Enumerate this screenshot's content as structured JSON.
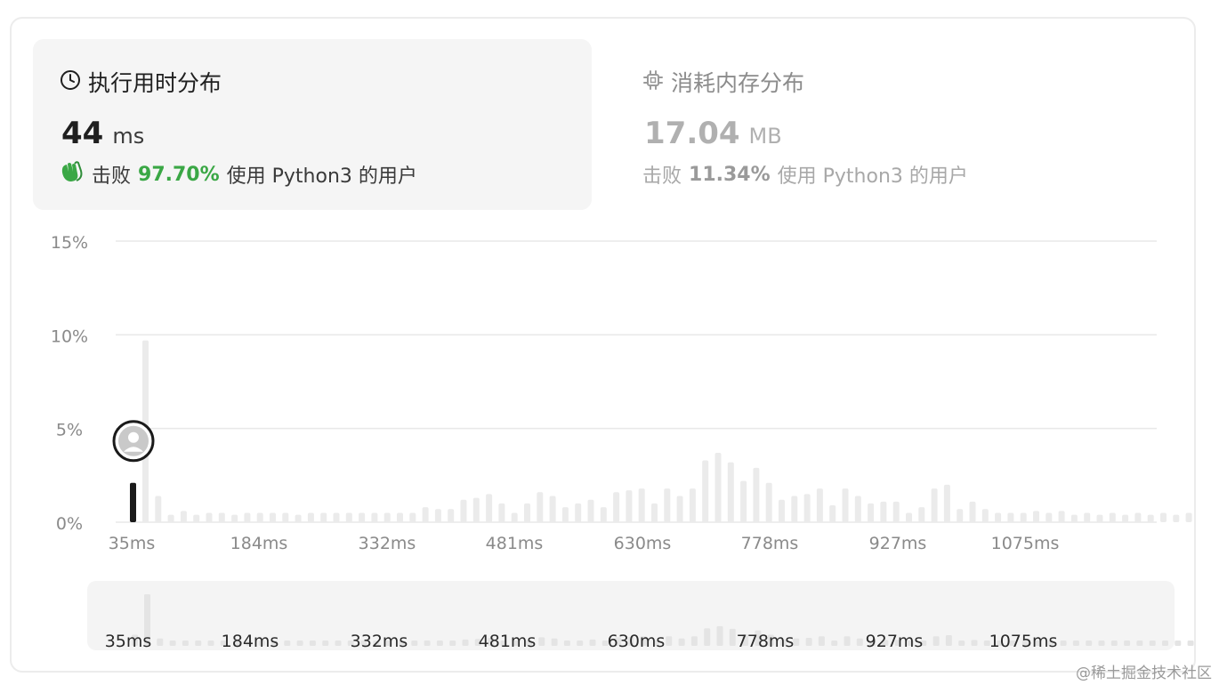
{
  "tabs": {
    "runtime": {
      "title": "执行用时分布",
      "value": "44",
      "unit": "ms",
      "beat_prefix": "击败",
      "beat_pct": "97.70%",
      "beat_suffix": "使用 Python3 的用户",
      "icon": "clock-icon",
      "badge_icon": "clapping-hands-icon"
    },
    "memory": {
      "title": "消耗内存分布",
      "value": "17.04",
      "unit": "MB",
      "beat_prefix": "击败",
      "beat_pct": "11.34%",
      "beat_suffix": "使用 Python3 的用户",
      "icon": "chip-icon"
    }
  },
  "watermark": "@稀土掘金技术社区",
  "colors": {
    "bar": "#ebebeb",
    "highlight_bar": "#1a1a1a",
    "pass_green": "#3aa745"
  },
  "chart_data": {
    "type": "bar",
    "ylim": [
      0,
      15
    ],
    "y_ticks": [
      "0%",
      "5%",
      "10%",
      "15%"
    ],
    "x_tick_labels": [
      "35ms",
      "184ms",
      "332ms",
      "481ms",
      "630ms",
      "778ms",
      "927ms",
      "1075ms"
    ],
    "values": [
      2.1,
      9.7,
      1.4,
      0.4,
      0.6,
      0.4,
      0.5,
      0.5,
      0.4,
      0.5,
      0.5,
      0.5,
      0.5,
      0.4,
      0.5,
      0.5,
      0.5,
      0.5,
      0.5,
      0.5,
      0.5,
      0.5,
      0.5,
      0.8,
      0.7,
      0.7,
      1.2,
      1.3,
      1.5,
      1.0,
      0.5,
      1.0,
      1.6,
      1.4,
      0.8,
      1.0,
      1.2,
      0.8,
      1.6,
      1.7,
      1.8,
      1.0,
      1.8,
      1.4,
      1.8,
      3.3,
      3.7,
      3.2,
      2.2,
      2.9,
      2.1,
      1.2,
      1.4,
      1.5,
      1.8,
      0.9,
      1.8,
      1.4,
      1.0,
      1.1,
      1.1,
      0.5,
      0.8,
      1.8,
      2.0,
      0.7,
      1.1,
      0.7,
      0.5,
      0.5,
      0.5,
      0.6,
      0.5,
      0.6,
      0.4,
      0.5,
      0.4,
      0.5,
      0.4,
      0.5,
      0.4,
      0.5,
      0.4,
      0.5
    ],
    "highlight_index": 0
  }
}
